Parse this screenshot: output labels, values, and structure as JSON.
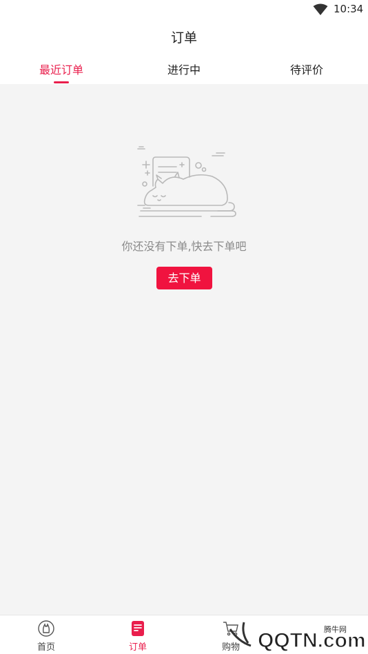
{
  "status_bar": {
    "time": "10:34"
  },
  "header": {
    "title": "订单"
  },
  "tabs": [
    {
      "label": "最近订单",
      "active": true
    },
    {
      "label": "进行中",
      "active": false
    },
    {
      "label": "待评价",
      "active": false
    }
  ],
  "empty_state": {
    "message": "你还没有下单,快去下单吧",
    "button_label": "去下单"
  },
  "bottom_nav": [
    {
      "label": "首页",
      "icon": "home-icon",
      "active": false
    },
    {
      "label": "订单",
      "icon": "order-icon",
      "active": true
    },
    {
      "label": "购物",
      "icon": "cart-icon",
      "active": false
    }
  ],
  "watermark": {
    "text": "QQTN.com",
    "subtext": "腾牛网"
  },
  "colors": {
    "accent": "#e91e4c",
    "button": "#f0133f",
    "background": "#f4f4f4"
  }
}
